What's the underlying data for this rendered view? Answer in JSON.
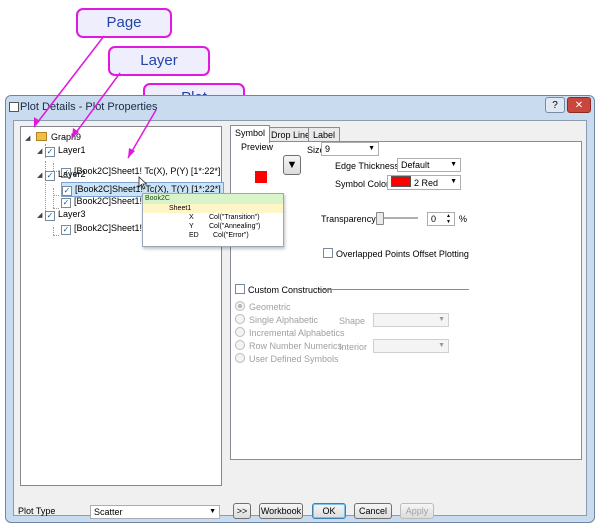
{
  "callouts": {
    "page": "Page",
    "layer": "Layer",
    "plot": "Plot"
  },
  "window": {
    "title": "Plot Details - Plot Properties",
    "help": "?",
    "close": "✕"
  },
  "tree": {
    "graph": "Graph9",
    "layer1": "Layer1",
    "layer1_plot": "[Book2C]Sheet1! Tc(X), P(Y) [1*:22*]",
    "layer2": "Layer2",
    "layer2_plot1": "[Book2C]Sheet1! Tc(X), T(Y) [1*:22*]",
    "layer2_plot2": "[Book2C]Sheet1! Tc(X), ...",
    "layer3": "Layer3",
    "layer3_plot": "[Book2C]Sheet1! Tc(X),"
  },
  "tooltip": {
    "book": "Book2C",
    "sheet": "Sheet1",
    "rows": [
      {
        "k": "X",
        "v": "Col(\"Transition\")"
      },
      {
        "k": "Y",
        "v": "Col(\"Annealing\")"
      },
      {
        "k": "ED",
        "v": "Col(\"Error\")"
      }
    ]
  },
  "tabs": [
    "Symbol",
    "Drop Lines",
    "Label"
  ],
  "symbol": {
    "preview_label": "Preview",
    "size_label": "Size",
    "size_value": "9",
    "edge_label": "Edge Thickness",
    "edge_value": "Default",
    "color_label": "Symbol Color",
    "color_value": "2 Red",
    "color_hex": "#ff0000",
    "transparency_label": "Transparency",
    "transparency_value": "0",
    "transparency_unit": "%",
    "overlap_label": "Overlapped Points Offset Plotting",
    "custom_label": "Custom Construction",
    "radios": [
      "Geometric",
      "Single Alphabetic",
      "Incremental Alphabetics",
      "Row Number Numerics",
      "User Defined Symbols"
    ],
    "shape_label": "Shape",
    "interior_label": "Interior"
  },
  "bottom": {
    "plot_type_label": "Plot Type",
    "plot_type_value": "Scatter",
    "expand": ">>",
    "workbook": "Workbook",
    "ok": "OK",
    "cancel": "Cancel",
    "apply": "Apply"
  },
  "colors": {
    "accent": "#e018e0",
    "selection": "#cce4f7",
    "symbol_red": "#ff0000"
  }
}
